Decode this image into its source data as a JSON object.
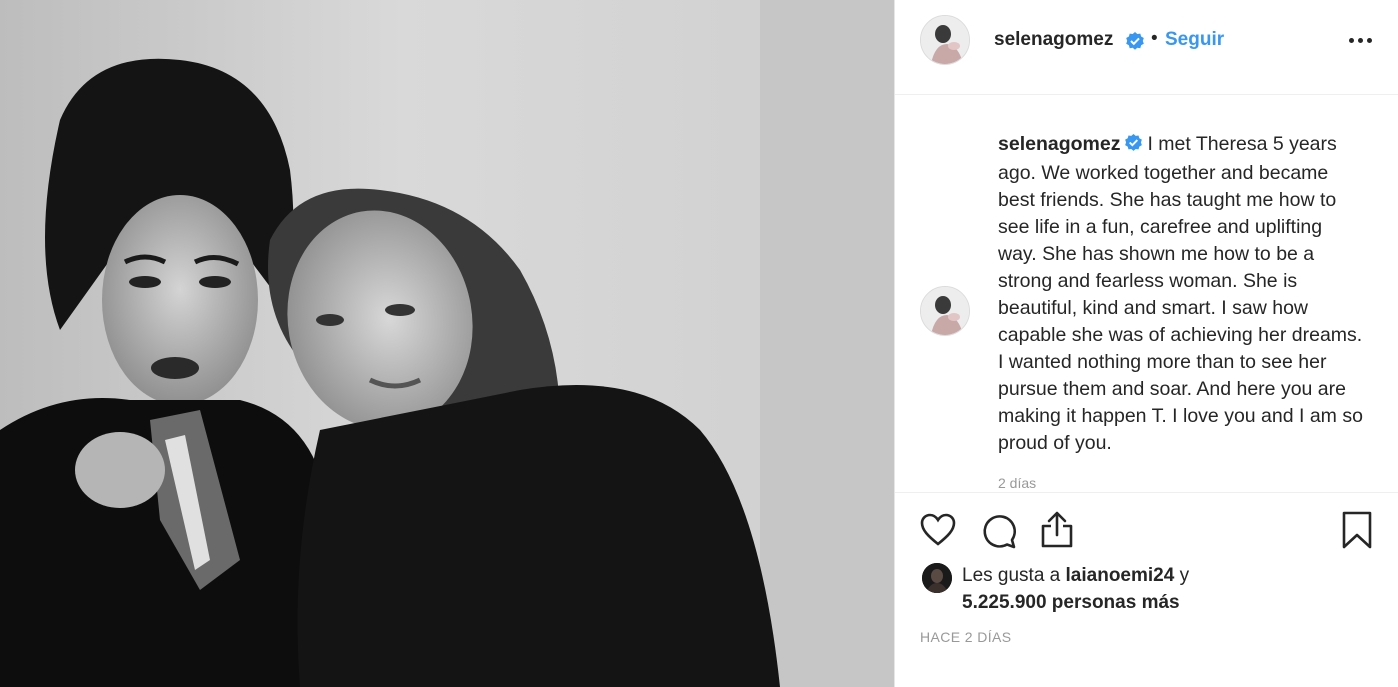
{
  "post": {
    "username": "selenagomez",
    "follow_label": "Seguir",
    "separator": "•",
    "caption_username": "selenagomez",
    "caption_text": "I met Theresa 5 years ago. We worked together and became best friends. She has taught me how to see life in a fun, carefree and uplifting way. She has shown me how to be a strong and fearless woman. She is beautiful, kind and smart. I saw how capable she was of achieving her dreams. I wanted nothing more than to see her pursue them and soar. And here you are making it happen T. I love you and I am so proud of you.",
    "caption_time": "2 días",
    "likes_prefix": "Les gusta a",
    "liked_by_user": "laianoemi24",
    "likes_conjunction": "y",
    "likes_others": "5.225.900 personas más",
    "posted_time": "HACE 2 DÍAS"
  },
  "icons": {
    "verified": "verified-badge-icon",
    "more": "more-options-icon",
    "like": "heart-icon",
    "comment": "comment-bubble-icon",
    "share": "share-icon",
    "save": "bookmark-icon"
  },
  "colors": {
    "accent": "#3897f0",
    "text": "#262626",
    "muted": "#999999"
  }
}
